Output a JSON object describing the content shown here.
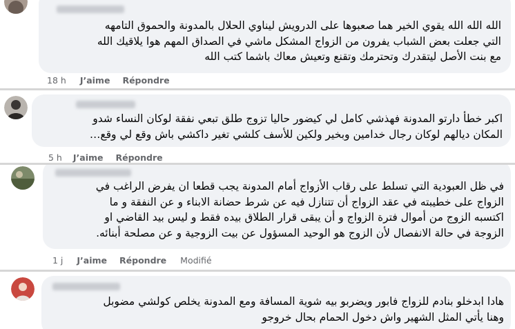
{
  "comments": [
    {
      "text": "الله الله الله يقوي الخير هما صعبوها على الدرويش ليناوي الحلال بالمدونة والحموق التامهه\nالتي جعلت بعض الشباب يفرون من الزواج المشكل ماشي في الصداق المهم هوا يلاقيك الله\nمع بنت الأصل ليتقدرك وتحترمك وتقنع وتعيش معاك باشما كتب الله",
      "time": "18 h",
      "like_label": "J’aime",
      "reply_label": "Répondre"
    },
    {
      "text": "اكبر خطأ دارتو المدونة فهذشي كامل لي كيضور حاليا تزوج طلق تبعي نفقة لوكان النساء شدو\nالمكان ديالهم لوكان رجال خدامين وبخير ولكين للأسف كلشي تغير داكشي باش وقع لي وقع…",
      "time": "5 h",
      "like_label": "J’aime",
      "reply_label": "Répondre"
    },
    {
      "text": "في ظل العبودية التي تسلط على رقاب الأزواج أمام المدونة يجب قطعا ان يفرض الراغب في\nالزواج على خطيبته في عقد الزواج أن تتنازل فيه عن شرط حضانة الابناء و عن النفقة و ما\nاكتسبه الزوج من أموال فترة الزواج و أن يبقى قرار الطلاق بيده فقط و ليس بيد القاضي او\nالزوجة في حالة الانفصال لأن الزوج هو الوحيد المسؤول عن بيت الزوجية و عن مصلحة أبنائه.",
      "time": "1 j",
      "like_label": "J’aime",
      "reply_label": "Répondre",
      "edited_label": "Modifié"
    },
    {
      "text": "هادا ابدخلو بنادم للزواج فابور ويضربو بيه شوية المسافة ومع المدونة يخلص كولشي مضوبل\nوهنا يأتي المثل الشهير واش دخول الحمام بحال خروجو"
    }
  ],
  "colors": {
    "bubble": "#f0f2f5",
    "meta": "#65676b",
    "text": "#050505",
    "separator": "#d6d6d6"
  }
}
